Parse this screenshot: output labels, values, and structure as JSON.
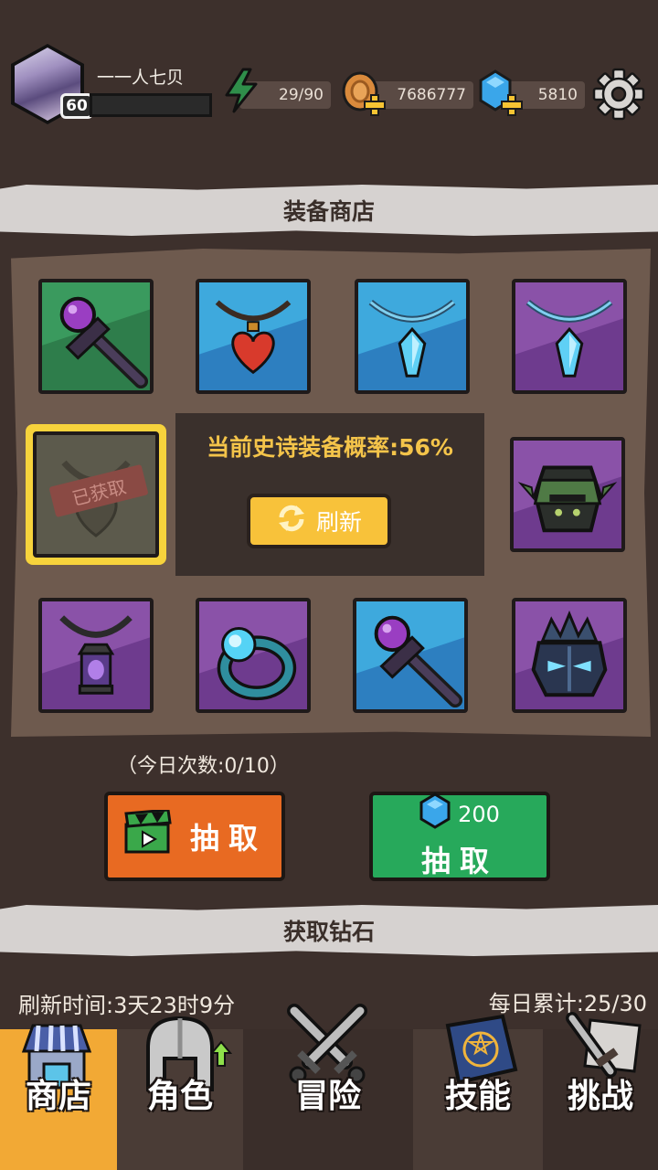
{
  "player": {
    "name": "一一人七贝",
    "level": "60"
  },
  "resources": {
    "energy": "29/90",
    "coins": "7686777",
    "gems": "5810"
  },
  "shop": {
    "title": "装备商店",
    "epic_rate": "当前史诗装备概率:56%",
    "refresh_label": "刷新",
    "obtained_stamp": "已获取",
    "daily_count": "（今日次数:0/10）",
    "draw_label": "抽取",
    "gem_draw_cost": "200",
    "gem_draw_label": "抽取",
    "items": [
      {
        "icon": "magic-staff-icon",
        "rarity": "green"
      },
      {
        "icon": "heart-necklace-icon",
        "rarity": "blue"
      },
      {
        "icon": "crystal-necklace-icon",
        "rarity": "blue"
      },
      {
        "icon": "crystal-necklace-icon",
        "rarity": "purple"
      },
      {
        "icon": "obtained-item-icon",
        "rarity": "gray"
      },
      {
        "icon": "spiked-helmet-icon",
        "rarity": "purple"
      },
      {
        "icon": "lantern-necklace-icon",
        "rarity": "purple"
      },
      {
        "icon": "frost-ring-icon",
        "rarity": "purple"
      },
      {
        "icon": "magic-staff-icon",
        "rarity": "blue"
      },
      {
        "icon": "dark-crown-helmet-icon",
        "rarity": "purple"
      }
    ],
    "colors": {
      "green": "#3a9a5e",
      "blue": "#3ea9dd",
      "purple": "#8a52a8",
      "gray": "#5c5a4c",
      "selected_border": "#f7d33c",
      "draw_orange": "#e86a22",
      "draw_green": "#27a95b"
    }
  },
  "diamonds": {
    "title": "获取钻石",
    "refresh_time": "刷新时间:3天23时9分",
    "daily_total": "每日累计:25/30"
  },
  "nav": {
    "tabs": [
      {
        "label": "商店",
        "icon": "shop-icon",
        "active": true
      },
      {
        "label": "角色",
        "icon": "helmet-icon",
        "active": false
      },
      {
        "label": "冒险",
        "icon": "crossed-swords-icon",
        "active": false
      },
      {
        "label": "技能",
        "icon": "spellbook-icon",
        "active": false
      },
      {
        "label": "挑战",
        "icon": "challenge-icon",
        "active": false
      }
    ]
  }
}
